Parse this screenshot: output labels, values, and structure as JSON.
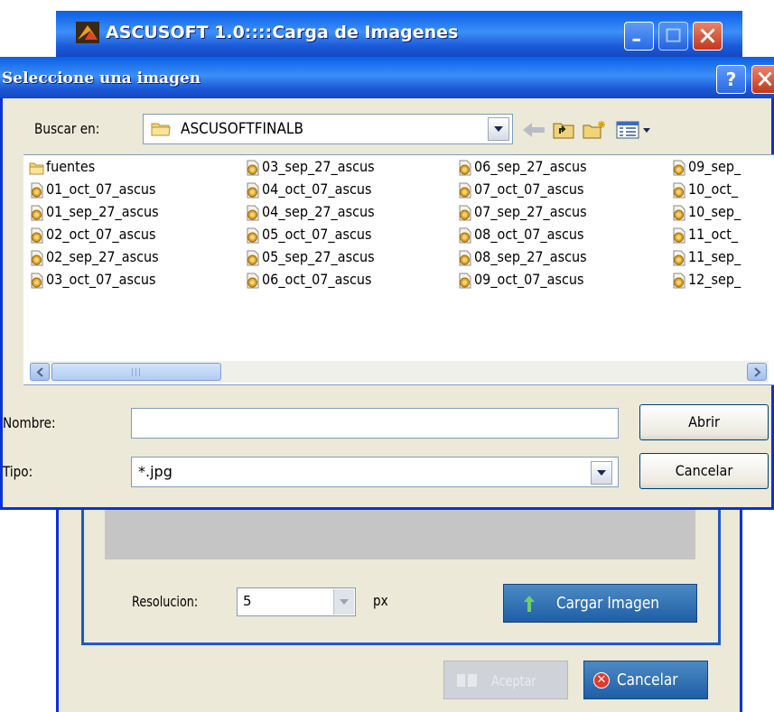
{
  "main_window": {
    "title": "ASCUSOFT 1.0::::Carga de Imagenes",
    "resolution_label": "Resolucion:",
    "resolution_value": "5",
    "unit_label": "px",
    "load_button_label": "Cargar Imagen",
    "accept_button_label": "Aceptar",
    "cancel_button_label": "Cancelar"
  },
  "dialog": {
    "title": "Seleccione una imagen",
    "help_label": "?",
    "look_in_label": "Buscar en:",
    "look_in_value": "ASCUSOFTFINALB",
    "columns": [
      {
        "items": [
          {
            "name": "fuentes",
            "type": "folder"
          },
          {
            "name": "01_oct_07_ascus",
            "type": "image"
          },
          {
            "name": "01_sep_27_ascus",
            "type": "image"
          },
          {
            "name": "02_oct_07_ascus",
            "type": "image"
          },
          {
            "name": "02_sep_27_ascus",
            "type": "image"
          },
          {
            "name": "03_oct_07_ascus",
            "type": "image"
          }
        ]
      },
      {
        "items": [
          {
            "name": "03_sep_27_ascus",
            "type": "image"
          },
          {
            "name": "04_oct_07_ascus",
            "type": "image"
          },
          {
            "name": "04_sep_27_ascus",
            "type": "image"
          },
          {
            "name": "05_oct_07_ascus",
            "type": "image"
          },
          {
            "name": "05_sep_27_ascus",
            "type": "image"
          },
          {
            "name": "06_oct_07_ascus",
            "type": "image"
          }
        ]
      },
      {
        "items": [
          {
            "name": "06_sep_27_ascus",
            "type": "image"
          },
          {
            "name": "07_oct_07_ascus",
            "type": "image"
          },
          {
            "name": "07_sep_27_ascus",
            "type": "image"
          },
          {
            "name": "08_oct_07_ascus",
            "type": "image"
          },
          {
            "name": "08_sep_27_ascus",
            "type": "image"
          },
          {
            "name": "09_oct_07_ascus",
            "type": "image"
          }
        ]
      },
      {
        "items": [
          {
            "name": "09_sep_",
            "type": "image"
          },
          {
            "name": "10_oct_",
            "type": "image"
          },
          {
            "name": "10_sep_",
            "type": "image"
          },
          {
            "name": "11_oct_",
            "type": "image"
          },
          {
            "name": "11_sep_",
            "type": "image"
          },
          {
            "name": "12_sep_",
            "type": "image"
          }
        ]
      }
    ],
    "filename_label": "Nombre:",
    "filename_value": "",
    "filetype_label": "Tipo:",
    "filetype_value": "*.jpg",
    "open_button_label": "Abrir",
    "cancel_button_label": "Cancelar"
  },
  "colors": {
    "xp_titlebar": "#0a5fe6",
    "window_face": "#ece9d8",
    "action_button": "#1e5ea6",
    "preview_area": "#c5c5c5"
  },
  "icons": [
    "app-icon",
    "minimize-icon",
    "maximize-icon",
    "close-icon",
    "help-icon",
    "folder-icon",
    "back-arrow-icon",
    "up-folder-icon",
    "new-folder-icon",
    "view-menu-icon",
    "image-file-icon",
    "dropdown-arrow-icon",
    "scroll-left-icon",
    "scroll-right-icon",
    "upload-arrow-icon",
    "cancel-x-icon",
    "accept-icon"
  ]
}
